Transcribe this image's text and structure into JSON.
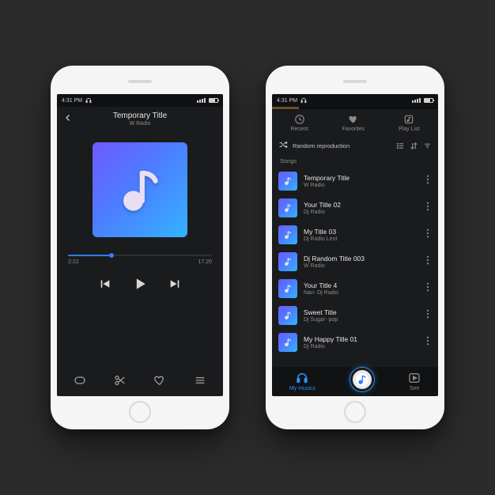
{
  "status": {
    "time": "4:31 PM"
  },
  "player": {
    "title": "Temporary Title",
    "subtitle": "W Radio",
    "elapsed": "2:22",
    "duration": "17:20",
    "progress_pct": 30
  },
  "tabs": {
    "recent": "Recent",
    "favorites": "Favorites",
    "playlist": "Play List"
  },
  "random_label": "Random reproduction",
  "section_label": "Songs",
  "songs": [
    {
      "title": "Temporary Title",
      "artist": "W Radio"
    },
    {
      "title": "Your Title 02",
      "artist": "Dj Radio"
    },
    {
      "title": "My Title 03",
      "artist": "Dj Radio Lent"
    },
    {
      "title": "Dj Random Title 003",
      "artist": "W Radio"
    },
    {
      "title": "Your Title 4",
      "artist": "Nan- Dj Radio"
    },
    {
      "title": "Sweet Title",
      "artist": "Dj Sugar- pop"
    },
    {
      "title": "My Happy Title 01",
      "artist": "Dj Radio"
    }
  ],
  "nav": {
    "mymusic": "My musics",
    "see": "See"
  }
}
